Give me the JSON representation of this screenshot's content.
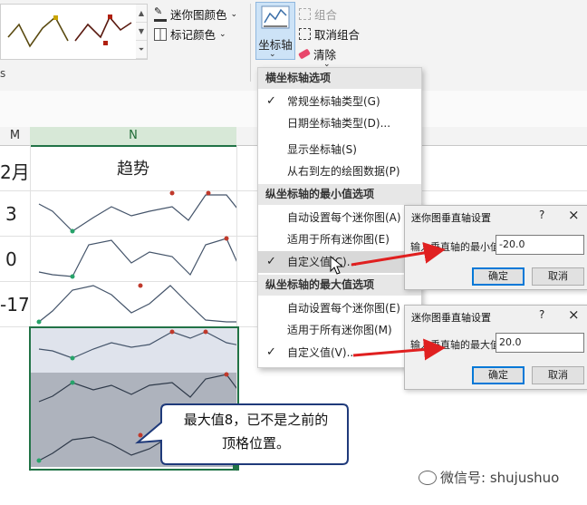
{
  "ribbon": {
    "sparkline_color_label": "迷你图颜色",
    "marker_color_label": "标记颜色",
    "axis_label": "坐标轴",
    "group_label": "组合",
    "ungroup_label": "取消组合",
    "clear_label": "清除",
    "left_letter": "s"
  },
  "sheet": {
    "columns": [
      "M",
      "N"
    ],
    "row_values": [
      "2月",
      "3",
      "0",
      "-17"
    ],
    "trend_header": "趋势"
  },
  "axis_menu": {
    "section_horizontal": "横坐标轴选项",
    "general_axis": "常规坐标轴类型(G)",
    "date_axis": "日期坐标轴类型(D)...",
    "show_axis": "显示坐标轴(S)",
    "right_to_left": "从右到左的绘图数据(P)",
    "section_vmin": "纵坐标轴的最小值选项",
    "min_auto_each": "自动设置每个迷你图(A)",
    "min_same_all": "适用于所有迷你图(E)",
    "min_custom": "自定义值(C)...",
    "section_vmax": "纵坐标轴的最大值选项",
    "max_auto_each": "自动设置每个迷你图(E)",
    "max_same_all": "适用于所有迷你图(M)",
    "max_custom": "自定义值(V)...",
    "check_mark": "✓"
  },
  "dialog_min": {
    "title": "迷你图垂直轴设置",
    "help": "?",
    "close": "×",
    "label": "输入垂直轴的最小值",
    "value": "-20.0",
    "ok": "确定",
    "cancel": "取消"
  },
  "dialog_max": {
    "title": "迷你图垂直轴设置",
    "help": "?",
    "close": "×",
    "label": "输入垂直轴的最大值",
    "value": "20.0",
    "ok": "确定",
    "cancel": "取消"
  },
  "callout": {
    "line1": "最大值8，已不是之前的",
    "line2": "顶格位置。"
  },
  "watermark": {
    "text": "微信号: shujushuo"
  },
  "colors": {
    "sparkline": "#44546a",
    "high_marker": "#c0392b",
    "low_marker": "#27a36a",
    "arrow": "#e02020",
    "selection_border": "#217346"
  }
}
